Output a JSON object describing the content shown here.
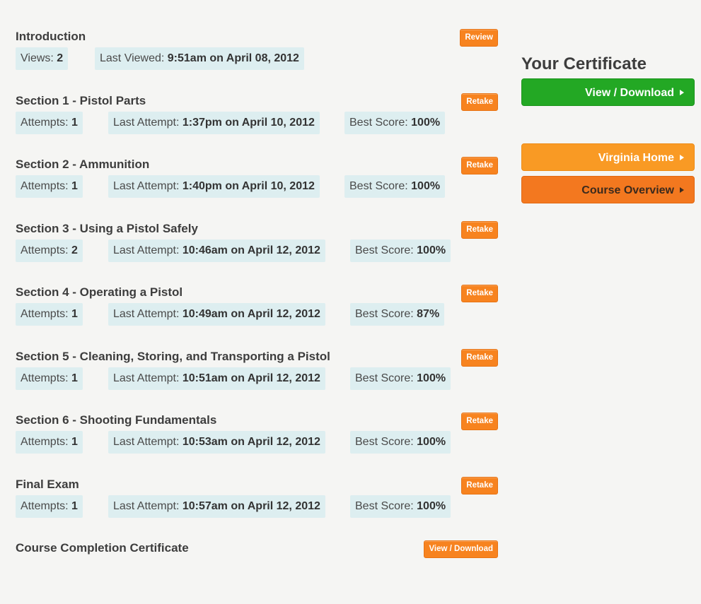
{
  "sections": [
    {
      "title": "Introduction",
      "button": "Review",
      "stats": [
        {
          "label": "Views:",
          "value": "2"
        },
        {
          "label": "Last Viewed:",
          "value": "9:51am on April 08, 2012"
        }
      ]
    },
    {
      "title": "Section 1 - Pistol Parts",
      "button": "Retake",
      "stats": [
        {
          "label": "Attempts:",
          "value": "1"
        },
        {
          "label": "Last Attempt:",
          "value": "1:37pm on April 10, 2012"
        },
        {
          "label": "Best Score:",
          "value": "100%"
        }
      ]
    },
    {
      "title": "Section 2 - Ammunition",
      "button": "Retake",
      "stats": [
        {
          "label": "Attempts:",
          "value": "1"
        },
        {
          "label": "Last Attempt:",
          "value": "1:40pm on April 10, 2012"
        },
        {
          "label": "Best Score:",
          "value": "100%"
        }
      ]
    },
    {
      "title": "Section 3 - Using a Pistol Safely",
      "button": "Retake",
      "stats": [
        {
          "label": "Attempts:",
          "value": "2"
        },
        {
          "label": "Last Attempt:",
          "value": "10:46am on April 12, 2012"
        },
        {
          "label": "Best Score:",
          "value": "100%"
        }
      ]
    },
    {
      "title": "Section 4 - Operating a Pistol",
      "button": "Retake",
      "stats": [
        {
          "label": "Attempts:",
          "value": "1"
        },
        {
          "label": "Last Attempt:",
          "value": "10:49am on April 12, 2012"
        },
        {
          "label": "Best Score:",
          "value": "87%"
        }
      ]
    },
    {
      "title": "Section 5 - Cleaning, Storing, and Transporting a Pistol",
      "button": "Retake",
      "stats": [
        {
          "label": "Attempts:",
          "value": "1"
        },
        {
          "label": "Last Attempt:",
          "value": "10:51am on April 12, 2012"
        },
        {
          "label": "Best Score:",
          "value": "100%"
        }
      ]
    },
    {
      "title": "Section 6 - Shooting Fundamentals",
      "button": "Retake",
      "stats": [
        {
          "label": "Attempts:",
          "value": "1"
        },
        {
          "label": "Last Attempt:",
          "value": "10:53am on April 12, 2012"
        },
        {
          "label": "Best Score:",
          "value": "100%"
        }
      ]
    },
    {
      "title": "Final Exam",
      "button": "Retake",
      "stats": [
        {
          "label": "Attempts:",
          "value": "1"
        },
        {
          "label": "Last Attempt:",
          "value": "10:57am on April 12, 2012"
        },
        {
          "label": "Best Score:",
          "value": "100%"
        }
      ]
    },
    {
      "title": "Course Completion Certificate",
      "button": "View / Download",
      "stats": []
    }
  ],
  "sidebar": {
    "heading": "Your Certificate",
    "view_download": "View / Download",
    "virginia_home": "Virginia Home",
    "course_overview": "Course Overview"
  },
  "colors": {
    "action_orange": "#f7831f",
    "stat_bg": "#ddeef0",
    "green": "#23a824",
    "orange_light": "#f99a24",
    "orange": "#f3781f"
  }
}
